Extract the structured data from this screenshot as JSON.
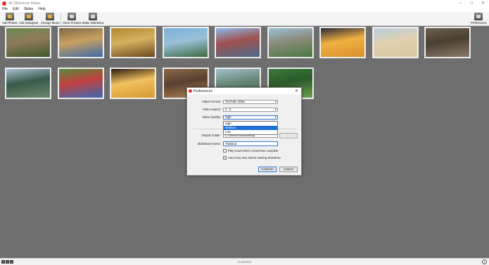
{
  "window": {
    "title": "4K Slideshow Maker",
    "minimize": "–",
    "maximize": "□",
    "close": "✕"
  },
  "menu": [
    "File",
    "Edit",
    "Slides",
    "Help"
  ],
  "toolbar": {
    "add_photos": "Add Photos",
    "add_instagram": "Add Instagram",
    "change_music": "Change Music",
    "show_preview": "Show Preview",
    "make_slideshow": "Make Slideshow",
    "preferences": "Preferences"
  },
  "photos": {
    "row1": [
      {
        "id": 1,
        "colors": [
          "#6a8a52",
          "#3d5a2e",
          "#8f7a5a"
        ]
      },
      {
        "id": 2,
        "colors": [
          "#7a6a4a",
          "#3b6aa8",
          "#c9a060"
        ]
      },
      {
        "id": 3,
        "colors": [
          "#b08830",
          "#6a4a20",
          "#d6b060"
        ]
      },
      {
        "id": 4,
        "colors": [
          "#7ab0d8",
          "#3d6a40",
          "#9ac0d8"
        ]
      },
      {
        "id": 5,
        "colors": [
          "#8ab8e8",
          "#4a6a8a",
          "#a05050"
        ]
      },
      {
        "id": 6,
        "colors": [
          "#9ac0d8",
          "#4a7a40",
          "#8a8a7a"
        ]
      },
      {
        "id": 7,
        "colors": [
          "#2a2a3a",
          "#d89030",
          "#f0b040"
        ]
      },
      {
        "id": 8,
        "colors": [
          "#b8d0e0",
          "#d8c8a0",
          "#e0d0b0"
        ]
      },
      {
        "id": 9,
        "colors": [
          "#6a6050",
          "#8a7a6a",
          "#4a4030"
        ]
      }
    ],
    "row2": [
      {
        "id": 10,
        "colors": [
          "#a8c0d8",
          "#6a8a6a",
          "#3a5a4a"
        ]
      },
      {
        "id": 11,
        "colors": [
          "#5a8a3a",
          "#3a6ab0",
          "#c04040"
        ]
      },
      {
        "id": 12,
        "colors": [
          "#2a1a10",
          "#d89a30",
          "#f0c060"
        ]
      },
      {
        "id": 13,
        "colors": [
          "#8a6a4a",
          "#b08050",
          "#5a4030"
        ]
      },
      {
        "id": 14,
        "colors": [
          "#a0c0d0",
          "#3a6a3a",
          "#6a8a7a"
        ]
      },
      {
        "id": 15,
        "colors": [
          "#3a7a3a",
          "#6aa050",
          "#2a5a2a"
        ]
      }
    ]
  },
  "status": {
    "photo_count": "15 photos",
    "social": [
      "f",
      "t",
      "v"
    ],
    "help": "?"
  },
  "dialog": {
    "title": "Preferences",
    "close": "✕",
    "video_format_label": "Video Format:",
    "video_format_value": "YouTube Video",
    "video_aspect_label": "Video Aspect:",
    "video_aspect_value": "4 : 3",
    "video_quality_label": "Video Quality:",
    "video_quality_value": "High",
    "quality_options": [
      "High",
      "Medium",
      "Low"
    ],
    "quality_highlighted": "Medium",
    "output_folder_label": "Output Folder:",
    "output_folder_value": "C:\\Users\\Paul\\Desktop",
    "browse_label": "...",
    "slideshow_name_label": "Slideshow Name:",
    "slideshow_name_value": "Thailand",
    "play_sound_label": "Play sound when conversion complete",
    "play_sound_checked": false,
    "ask_every_time_label": "Ask every time before making slideshow",
    "ask_every_time_checked": true,
    "continue_label": "Continue",
    "cancel_label": "Cancel"
  }
}
